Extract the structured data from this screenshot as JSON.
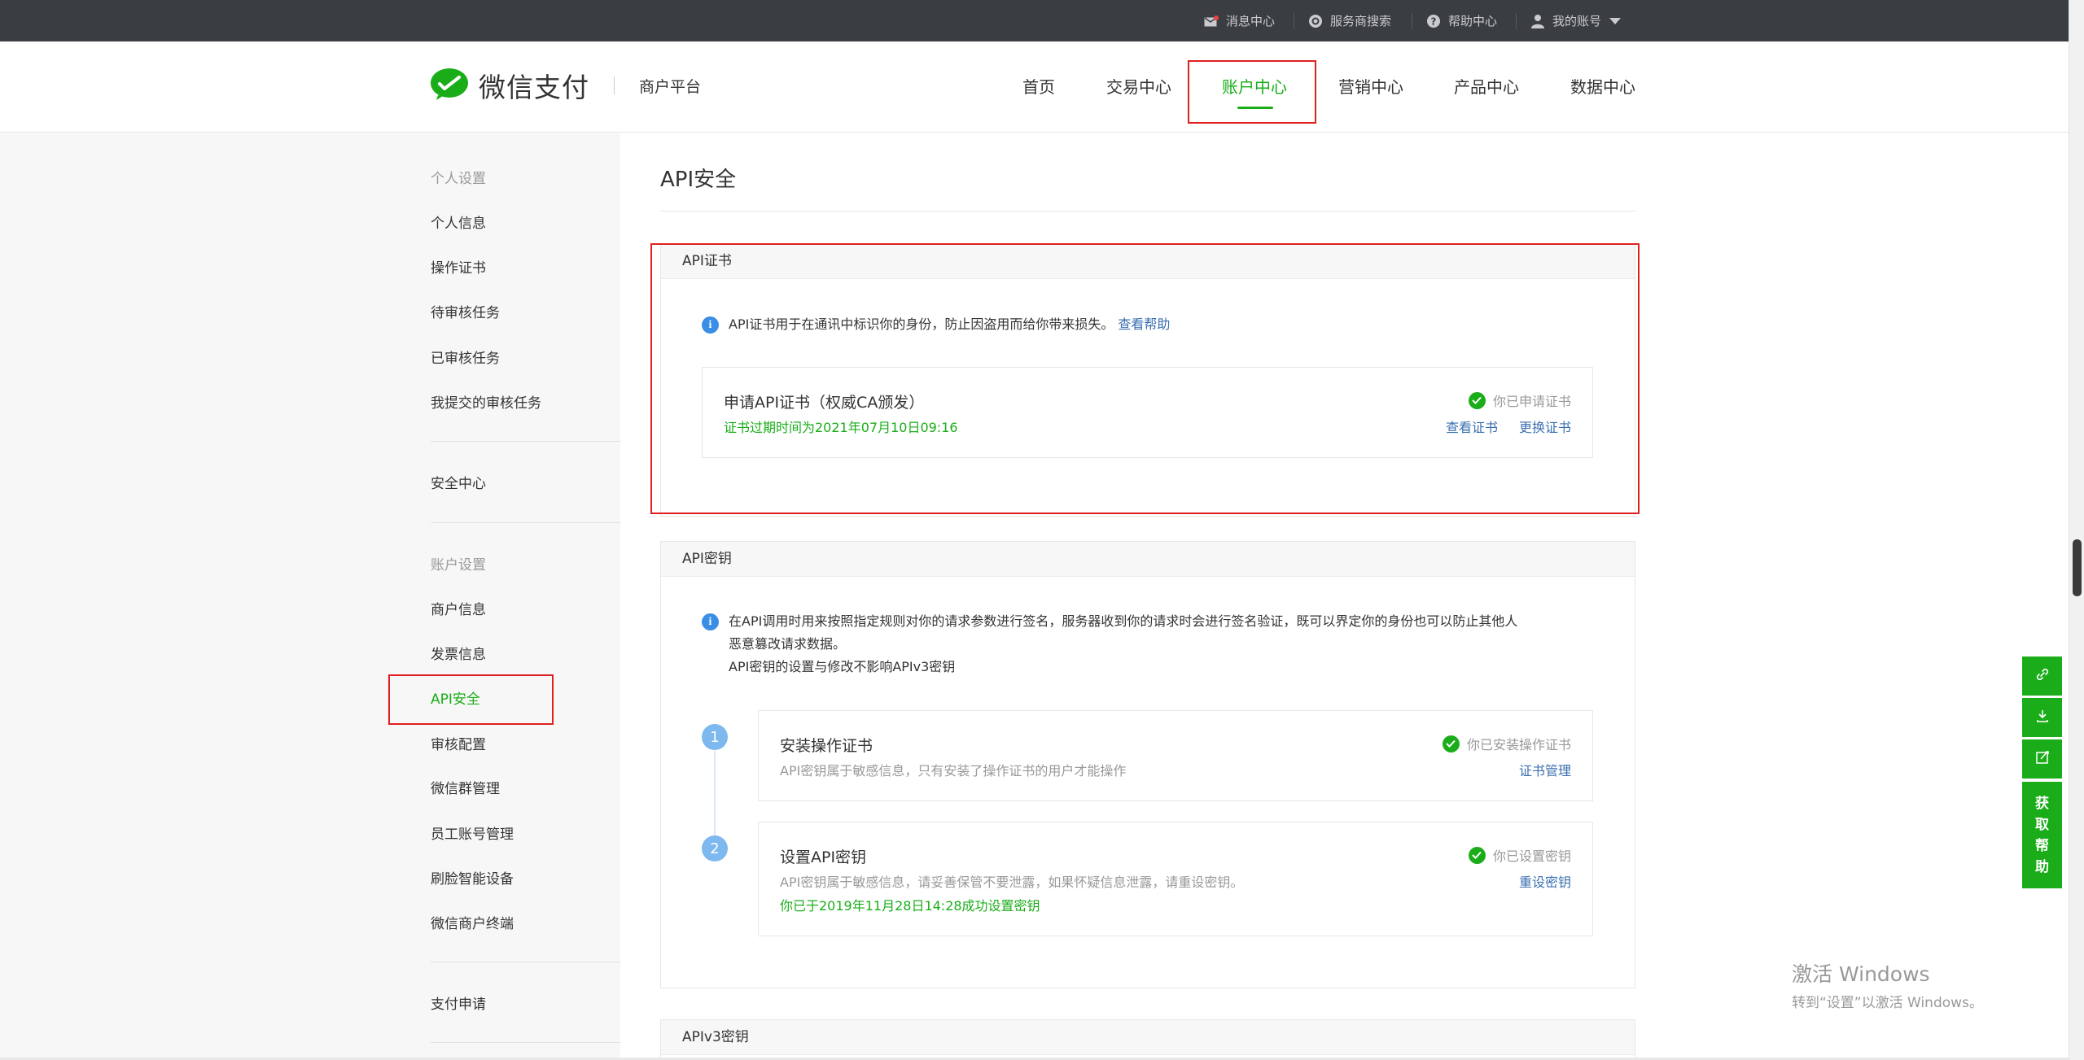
{
  "topbar": {
    "messages": "消息中心",
    "provider_search": "服务商搜索",
    "help": "帮助中心",
    "account": "我的账号"
  },
  "header": {
    "brand": "微信支付",
    "platform": "商户平台",
    "nav": [
      "首页",
      "交易中心",
      "账户中心",
      "营销中心",
      "产品中心",
      "数据中心"
    ],
    "active_nav": "账户中心"
  },
  "sidebar": {
    "group1_title": "个人设置",
    "group1": [
      "个人信息",
      "操作证书",
      "待审核任务",
      "已审核任务",
      "我提交的审核任务"
    ],
    "security": "安全中心",
    "group2_title": "账户设置",
    "group2": [
      "商户信息",
      "发票信息",
      "API安全",
      "审核配置",
      "微信群管理",
      "员工账号管理",
      "刷脸智能设备",
      "微信商户终端"
    ],
    "pay_apply": "支付申请",
    "active": "API安全"
  },
  "main": {
    "title": "API安全",
    "cert_panel": {
      "header": "API证书",
      "info_text": "API证书用于在通讯中标识你的身份，防止因盗用而给你带来损失。",
      "info_link": "查看帮助",
      "card_title": "申请API证书（权威CA颁发）",
      "card_expiry": "证书过期时间为2021年07月10日09:16",
      "status": "你已申请证书",
      "view_cert": "查看证书",
      "replace_cert": "更换证书"
    },
    "key_panel": {
      "header": "API密钥",
      "info_line1": "在API调用时用来按照指定规则对你的请求参数进行签名，服务器收到你的请求时会进行签名验证，既可以界定你的身份也可以防止其他人",
      "info_line2": "恶意篡改请求数据。",
      "info_line3": "API密钥的设置与修改不影响APIv3密钥",
      "step1": {
        "num": "1",
        "title": "安装操作证书",
        "desc": "API密钥属于敏感信息，只有安装了操作证书的用户才能操作",
        "status": "你已安装操作证书",
        "action": "证书管理"
      },
      "step2": {
        "num": "2",
        "title": "设置API密钥",
        "desc": "API密钥属于敏感信息，请妥善保管不要泄露，如果怀疑信息泄露，请重设密钥。",
        "done": "你已于2019年11月28日14:28成功设置密钥",
        "status": "你已设置密钥",
        "action": "重设密钥"
      }
    },
    "v3_panel": {
      "header": "APIv3密钥"
    }
  },
  "float_help": [
    "获",
    "取",
    "帮",
    "助"
  ],
  "watermark": {
    "line1": "激活 Windows",
    "line2": "转到“设置”以激活 Windows。"
  },
  "colors": {
    "brand_green": "#1aad19",
    "link_blue": "#3a6fb0",
    "highlight_red": "#e02020",
    "topbar_bg": "#3a3d42"
  }
}
